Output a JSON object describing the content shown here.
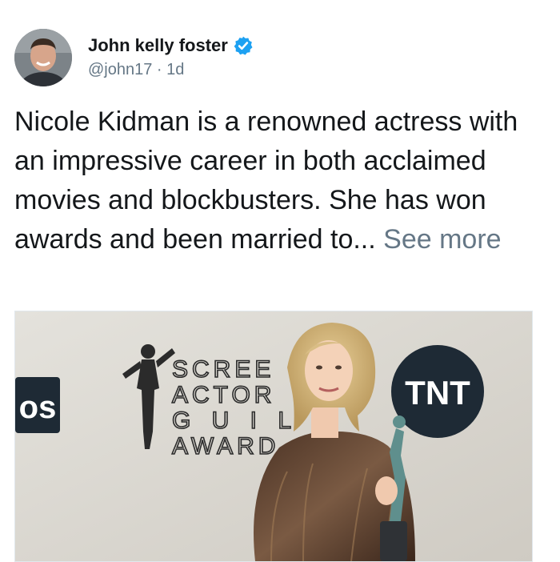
{
  "tweet": {
    "author": {
      "display_name": "John kelly foster",
      "handle": "@john17",
      "separator": " · ",
      "time_ago": "1d",
      "verified": true,
      "avatar_icon": "profile-photo"
    },
    "text": "Nicole Kidman is a renowned actress with an impressive career in both acclaimed movies and blockbusters. She has won awards and been married to...",
    "see_more_label": "See more",
    "media": {
      "backdrop_letters_left": "os",
      "backdrop_lines": [
        "SCREE",
        "ACTOR",
        "G U I L",
        "AWARD"
      ],
      "backdrop_logo_right": "TNT"
    }
  },
  "colors": {
    "text": "#14171a",
    "muted": "#657786",
    "verified_blue": "#1da1f2",
    "logo_dark": "#1e2a35"
  }
}
